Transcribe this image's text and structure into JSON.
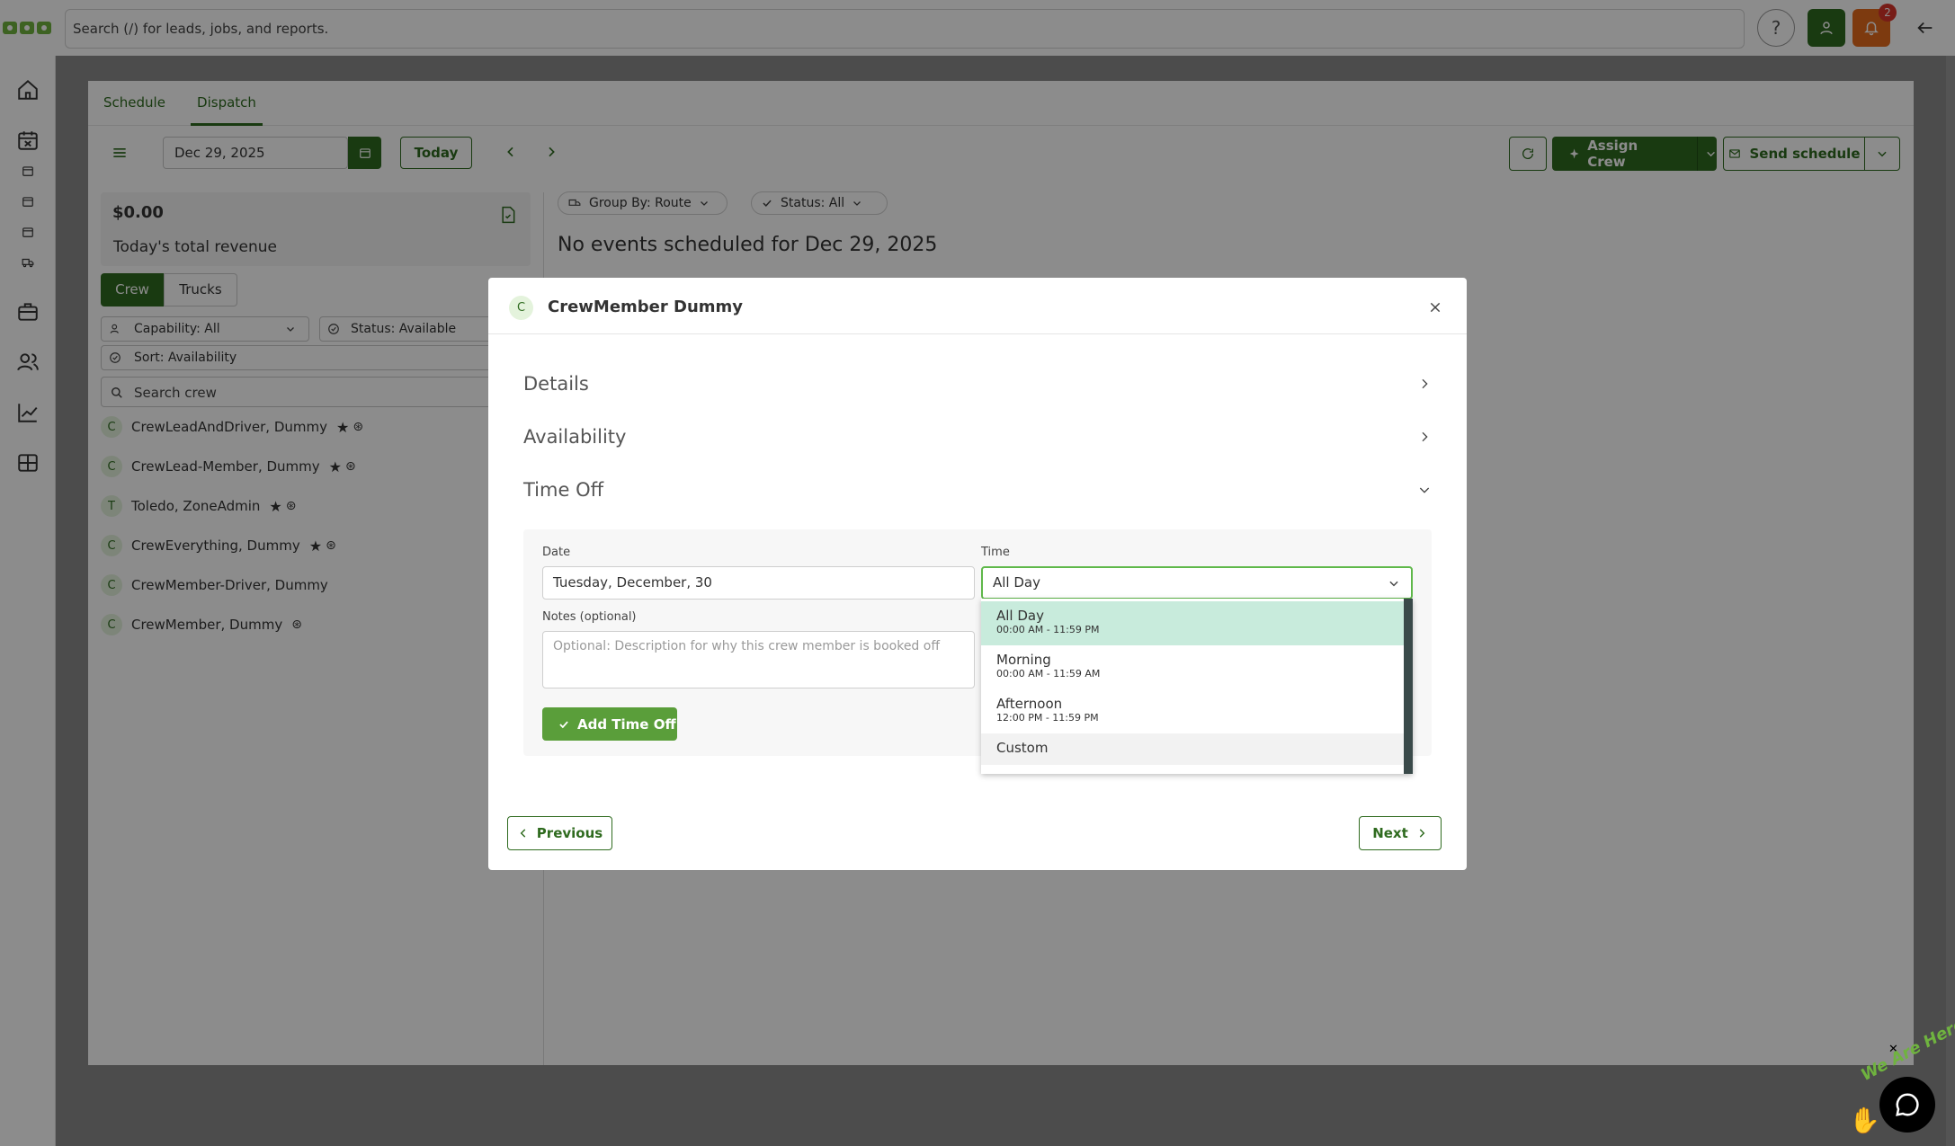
{
  "header": {
    "search_placeholder": "Search (/) for leads, jobs, and reports.",
    "help_label": "?",
    "notification_count": "2"
  },
  "tabs": [
    {
      "label": "Schedule",
      "active": false
    },
    {
      "label": "Dispatch",
      "active": true
    }
  ],
  "toolbar": {
    "date_value": "Dec 29, 2025",
    "today_label": "Today",
    "assign_crew_label": "Assign Crew",
    "send_schedule_label": "Send schedule"
  },
  "revenue": {
    "amount": "$0.00",
    "label": "Today's total revenue"
  },
  "crew_tabs": [
    {
      "label": "Crew",
      "active": true
    },
    {
      "label": "Trucks",
      "active": false
    }
  ],
  "filters": {
    "capability": "Capability: All",
    "status": "Status: Available",
    "sort": "Sort: Availability",
    "search_placeholder": "Search crew"
  },
  "crew_list": [
    {
      "initial": "C",
      "name": "CrewLeadAndDriver, Dummy",
      "star": true,
      "steering": true
    },
    {
      "initial": "C",
      "name": "CrewLead-Member, Dummy",
      "star": true,
      "steering": true
    },
    {
      "initial": "T",
      "name": "Toledo, ZoneAdmin",
      "star": true,
      "steering": true
    },
    {
      "initial": "C",
      "name": "CrewEverything, Dummy",
      "star": true,
      "steering": true
    },
    {
      "initial": "C",
      "name": "CrewMember-Driver, Dummy",
      "star": false,
      "steering": false
    },
    {
      "initial": "C",
      "name": "CrewMember, Dummy",
      "star": false,
      "steering": true
    }
  ],
  "schedule_filters": {
    "group_by": "Group By: Route",
    "status": "Status: All"
  },
  "empty_message": "No events scheduled for Dec 29, 2025",
  "modal": {
    "avatar_initial": "C",
    "title": "CrewMember Dummy",
    "sections": {
      "details": "Details",
      "availability": "Availability",
      "time_off": "Time Off"
    },
    "date_label": "Date",
    "date_value": "Tuesday, December, 30",
    "time_label": "Time",
    "time_value": "All Day",
    "notes_label": "Notes (optional)",
    "notes_placeholder": "Optional: Description for why this crew member is booked off",
    "add_time_off_label": "Add Time Off",
    "time_options": [
      {
        "label": "All Day",
        "sub": "00:00 AM - 11:59 PM",
        "selected": true
      },
      {
        "label": "Morning",
        "sub": "00:00 AM - 11:59 AM",
        "selected": false
      },
      {
        "label": "Afternoon",
        "sub": "12:00 PM - 11:59 PM",
        "selected": false
      },
      {
        "label": "Custom",
        "sub": "",
        "selected": false
      }
    ],
    "previous_label": "Previous",
    "next_label": "Next"
  },
  "chat_widget": {
    "text": "We Are Here!"
  },
  "colors": {
    "brand_green": "#2f6b1f",
    "button_green": "#5a9e3a",
    "selected_option": "#c8ebdc",
    "notification_orange": "#e36a1c",
    "notification_badge": "#d9342b"
  }
}
